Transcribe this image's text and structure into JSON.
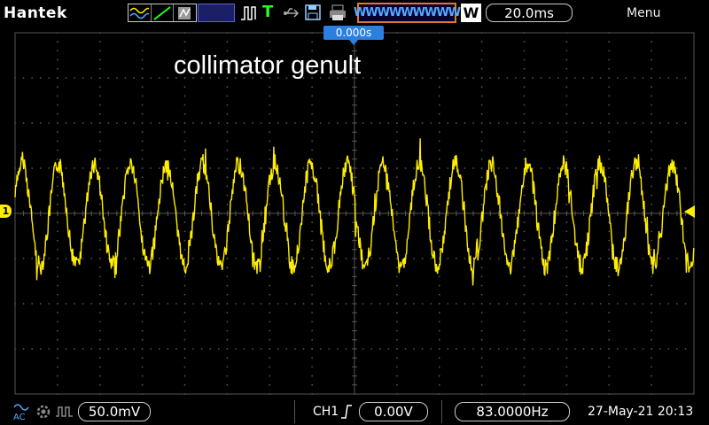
{
  "header": {
    "brand": "Hantek",
    "run_icon": "waveform-mode-icon",
    "trigger_marker": "T",
    "waveform_preview": "WWWWWWWWW",
    "window_label": "W",
    "timebase": "20.0ms",
    "menu_label": "Menu"
  },
  "screen": {
    "trigger_time": "0.000s",
    "annotation": "collimator genult",
    "ch1_marker": "1"
  },
  "footer": {
    "volts_per_div": "50.0mV",
    "ch_label": "CH1",
    "trigger_level": "0.00V",
    "frequency": "83.0000Hz",
    "datetime": "27-May-21 20:13"
  },
  "colors": {
    "trace": "#ffee00",
    "grid": "#555555",
    "accent_blue": "#2a7fe0",
    "frame_orange": "#e07a2a"
  }
}
